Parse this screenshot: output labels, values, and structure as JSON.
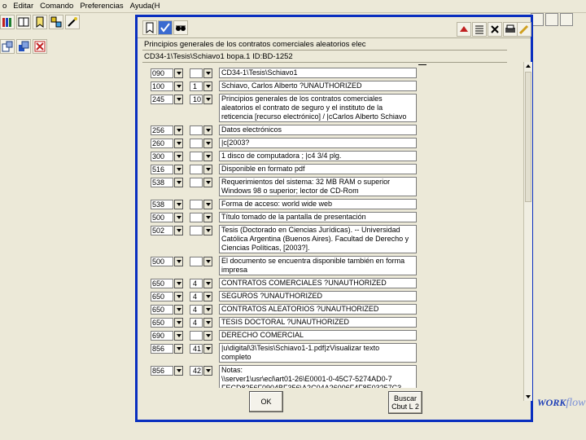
{
  "menu": [
    "o",
    "Editar",
    "Comando",
    "Preferencias",
    "Ayuda(H"
  ],
  "dialog": {
    "title_line": "Principios generales de los contratos comerciales aleatorios elec",
    "id_line": "CD34-1\\Tesis\\Schiavo1   bopa.1   ID:BD-1252"
  },
  "records": [
    {
      "tag": "090",
      "ind": "",
      "value": "CD34-1\\Tesis\\Schiavo1"
    },
    {
      "tag": "100",
      "ind": "1",
      "value": "Schiavo, Carlos Alberto ?UNAUTHORIZED"
    },
    {
      "tag": "245",
      "ind": "10",
      "value": "Principios generales de los contratos comerciales\naleatorios el contrato de seguro y el instituto de la\nreticencia [recurso electrónico] / |cCarlos Alberto Schiavo"
    },
    {
      "tag": "256",
      "ind": "",
      "value": "Datos electrónicos"
    },
    {
      "tag": "260",
      "ind": "",
      "value": "|c[2003?"
    },
    {
      "tag": "300",
      "ind": "",
      "value": "1 disco de computadora ; |c4 3/4 plg."
    },
    {
      "tag": "516",
      "ind": "",
      "value": "Disponible en formato pdf"
    },
    {
      "tag": "538",
      "ind": "",
      "value": "Requerimientos del sistema: 32 MB RAM o superior\nWindows 98 o superior; lector de CD-Rom"
    },
    {
      "tag": "538",
      "ind": "",
      "value": "Forma de acceso: world wide web"
    },
    {
      "tag": "500",
      "ind": "",
      "value": "Título tomado de la pantalla de presentación"
    },
    {
      "tag": "502",
      "ind": "",
      "value": "Tesis (Doctorado en Ciencias Jurídicas). -- Universidad\nCatólica Argentina (Buenos Aires). Facultad de Derecho y\nCiencias Políticas, [2003?]."
    },
    {
      "tag": "500",
      "ind": "",
      "value": "El documento se encuentra disponible también en forma\nimpresa"
    },
    {
      "tag": "650",
      "ind": "4",
      "value": "CONTRATOS COMERCIALES ?UNAUTHORIZED"
    },
    {
      "tag": "650",
      "ind": "4",
      "value": "SEGUROS ?UNAUTHORIZED"
    },
    {
      "tag": "650",
      "ind": "4",
      "value": "CONTRATOS ALEATORIOS ?UNAUTHORIZED"
    },
    {
      "tag": "650",
      "ind": "4",
      "value": "TESIS DOCTORAL ?UNAUTHORIZED"
    },
    {
      "tag": "690",
      "ind": "",
      "value": "DERECHO COMERCIAL"
    },
    {
      "tag": "856",
      "ind": "41",
      "value": "|u\\digital\\3\\Tesis\\Schiavo1-1.pdf|zVisualizar texto\ncompleto"
    },
    {
      "tag": "856",
      "ind": "42",
      "value": "Notas:\n\\\\server1\\usr\\ecl\\art01-26\\E0001-0-45C7-5274AD0-7\nFECD8256F0904BF356\\A2C04A26006F4F8E03257C3\nA0067475F"
    }
  ],
  "buttons": {
    "ok": "OK",
    "buscar_line1": "Buscar",
    "buscar_line2": "Cbut L 2"
  },
  "logo": {
    "text": "WORK",
    "tail": "flow"
  }
}
